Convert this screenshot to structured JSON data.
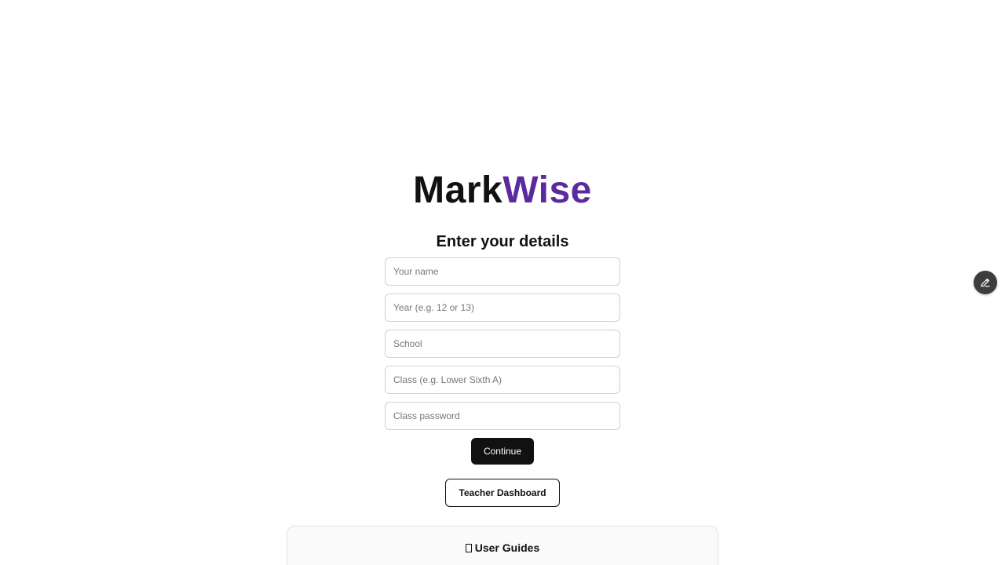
{
  "brand": {
    "part1": "Mark",
    "part2": "Wise",
    "part1_color": "#111111",
    "part2_color": "#5b2a9c"
  },
  "form": {
    "heading": "Enter your details",
    "fields": [
      {
        "placeholder": "Your name",
        "value": ""
      },
      {
        "placeholder": "Year (e.g. 12 or 13)",
        "value": ""
      },
      {
        "placeholder": "School",
        "value": ""
      },
      {
        "placeholder": "Class (e.g. Lower Sixth A)",
        "value": ""
      },
      {
        "placeholder": "Class password",
        "value": ""
      }
    ],
    "continue_label": "Continue"
  },
  "teacher_dashboard_label": "Teacher Dashboard",
  "user_guides": {
    "icon": "book-icon",
    "title": "User Guides"
  },
  "floating_button": {
    "icon": "pencil-icon",
    "color": "#3d3d3d"
  }
}
